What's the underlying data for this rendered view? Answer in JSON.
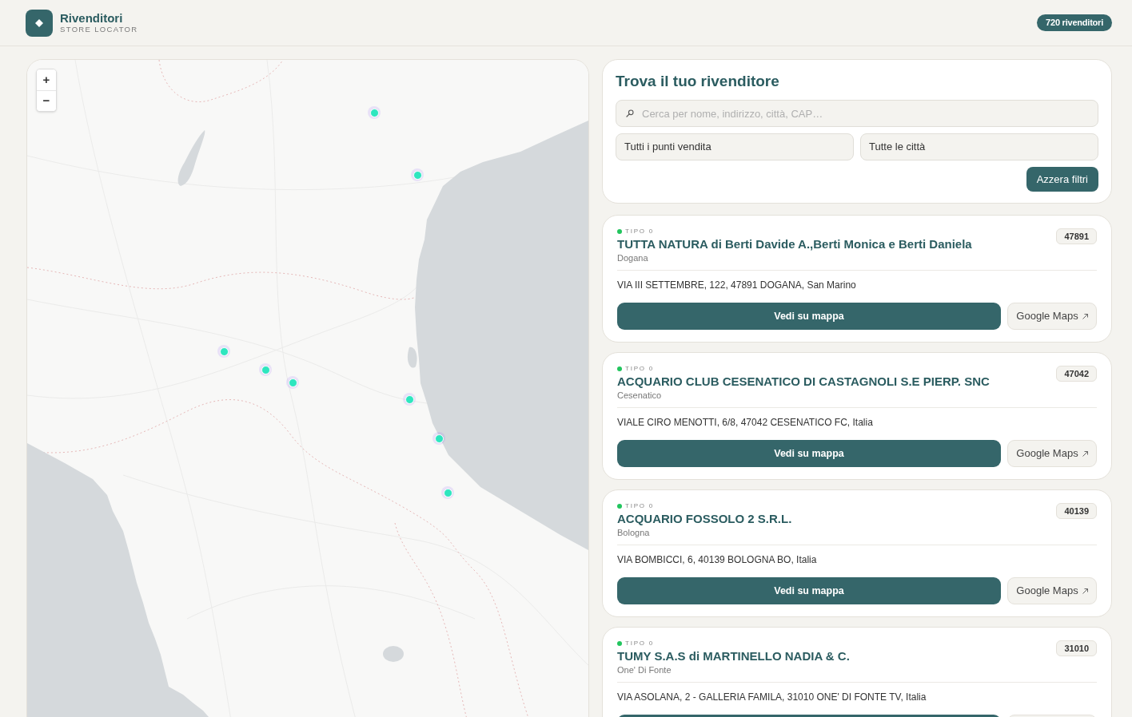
{
  "header": {
    "title": "Rivenditori",
    "subtitle": "STORE LOCATOR",
    "count_badge": "720 rivenditori"
  },
  "map": {
    "zoom_controls": [
      "+",
      "−"
    ]
  },
  "search_panel": {
    "title": "Trova il tuo rivenditore",
    "search": {
      "placeholder": "Cerca per nome, indirizzo, città, CAP…"
    },
    "filters": [
      {
        "value": "Tutti i punti vendita"
      },
      {
        "value": "Tutte le città"
      }
    ],
    "reset_button": "Azzera filtri"
  },
  "stores": [
    {
      "type_label": "TIPO 0",
      "color": "#22c55e",
      "name": "TUTTA NATURA di Berti Davide A.,Berti Monica e Berti Daniela",
      "city": "Dogana",
      "postcode": "47891",
      "address": "VIA III SETTEMBRE, 122, 47891 DOGANA, San Marino",
      "actions": [
        {
          "kind": "map",
          "label": "Vedi su mappa"
        },
        {
          "kind": "external",
          "label": "Google Maps"
        }
      ]
    },
    {
      "type_label": "TIPO 0",
      "color": "#22c55e",
      "name": "ACQUARIO CLUB CESENATICO DI CASTAGNOLI S.E PIERP. SNC",
      "city": "Cesenatico",
      "postcode": "47042",
      "address": "VIALE CIRO MENOTTI, 6/8, 47042 CESENATICO FC, Italia",
      "actions": [
        {
          "kind": "map",
          "label": "Vedi su mappa"
        },
        {
          "kind": "external",
          "label": "Google Maps"
        }
      ]
    },
    {
      "type_label": "TIPO 0",
      "color": "#22c55e",
      "name": "ACQUARIO FOSSOLO 2 S.R.L.",
      "city": "Bologna",
      "postcode": "40139",
      "address": "VIA BOMBICCI, 6, 40139 BOLOGNA BO, Italia",
      "actions": [
        {
          "kind": "map",
          "label": "Vedi su mappa"
        },
        {
          "kind": "external",
          "label": "Google Maps"
        }
      ]
    },
    {
      "type_label": "TIPO 0",
      "color": "#22c55e",
      "name": "TUMY S.A.S di MARTINELLO NADIA & C.",
      "city": "One' Di Fonte",
      "postcode": "31010",
      "address": "VIA ASOLANA, 2 - GALLERIA FAMILA, 31010 ONE' DI FONTE TV, Italia",
      "actions": [
        {
          "kind": "map"
        },
        {
          "kind": "external"
        }
      ]
    }
  ]
}
